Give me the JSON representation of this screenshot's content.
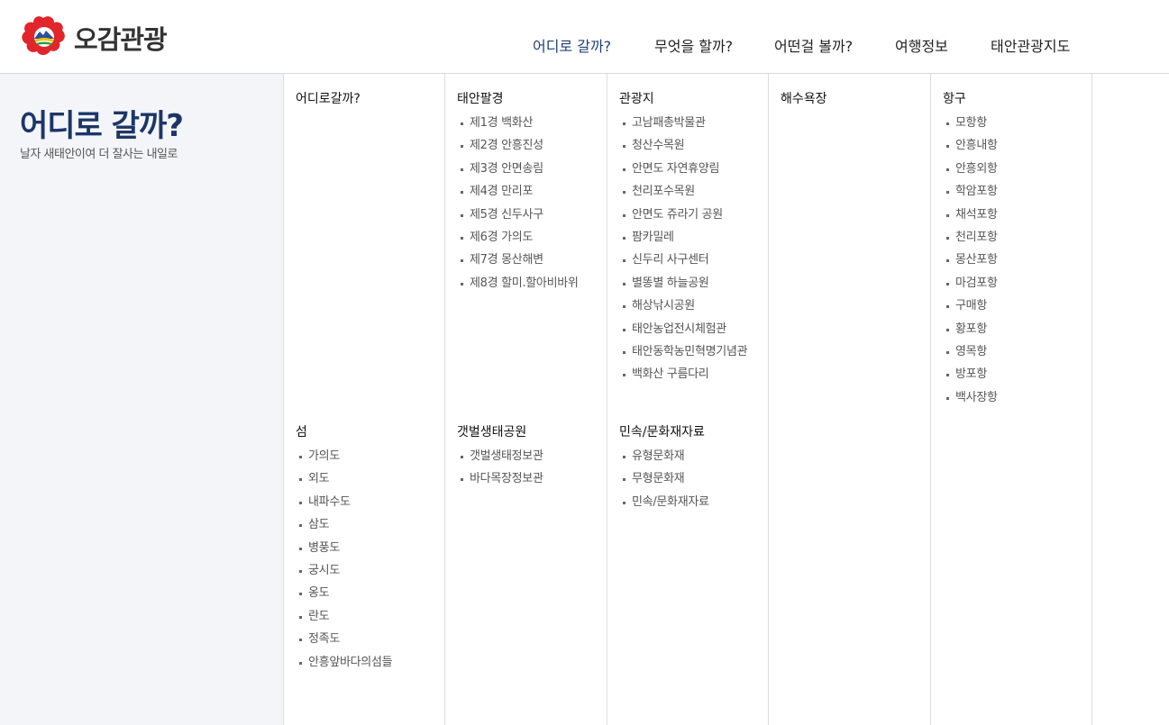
{
  "logo": {
    "text": "오감관광",
    "icon": "taean-flower-logo-icon"
  },
  "nav": {
    "items": [
      {
        "label": "어디로 갈까?",
        "active": true
      },
      {
        "label": "무엇을 할까?",
        "active": false
      },
      {
        "label": "어떤걸 볼까?",
        "active": false
      },
      {
        "label": "여행정보",
        "active": false
      },
      {
        "label": "태안관광지도",
        "active": false
      }
    ]
  },
  "side": {
    "title": "어디로 갈까?",
    "subtitle": "날자 새태안이여 더 잘사는 내일로"
  },
  "columns": [
    {
      "top": {
        "title": "어디로갈까?",
        "items": []
      },
      "bottom": {
        "title": "섬",
        "items": [
          "가의도",
          "외도",
          "내파수도",
          "삼도",
          "병풍도",
          "궁시도",
          "옹도",
          "란도",
          "정족도",
          "안흥앞바다의섬들"
        ]
      }
    },
    {
      "top": {
        "title": "태안팔경",
        "items": [
          "제1경 백화산",
          "제2경 안흥진성",
          "제3경 안면송림",
          "제4경 만리포",
          "제5경 신두사구",
          "제6경 가의도",
          "제7경 몽산해변",
          "제8경 할미.할아비바위"
        ]
      },
      "bottom": {
        "title": "갯벌생태공원",
        "items": [
          "갯벌생태정보관",
          "바다목장정보관"
        ]
      }
    },
    {
      "top": {
        "title": "관광지",
        "items": [
          "고남패총박물관",
          "청산수목원",
          "안면도 자연휴양림",
          "천리포수목원",
          "안면도 쥬라기 공원",
          "팜카밀레",
          "신두리 사구센터",
          "별똥별 하늘공원",
          "해상낚시공원",
          "태안농업전시체험관",
          "태안동학농민혁명기념관",
          "백화산 구름다리"
        ]
      },
      "bottom": {
        "title": "민속/문화재자료",
        "items": [
          "유형문화재",
          "무형문화재",
          "민속/문화재자료"
        ]
      }
    },
    {
      "top": {
        "title": "해수욕장",
        "items": []
      },
      "bottom": {
        "title": "",
        "items": []
      }
    },
    {
      "top": {
        "title": "항구",
        "items": [
          "모항항",
          "안흥내항",
          "안흥외항",
          "학암포항",
          "채석포항",
          "천리포항",
          "몽산포항",
          "마검포항",
          "구매항",
          "황포항",
          "영목항",
          "방포항",
          "백사장항"
        ]
      },
      "bottom": {
        "title": "",
        "items": []
      }
    }
  ],
  "colors": {
    "accent": "#1c3668",
    "active_nav": "#1f3f78",
    "logo_red": "#e1262b",
    "side_bg": "#f4f5f8"
  }
}
